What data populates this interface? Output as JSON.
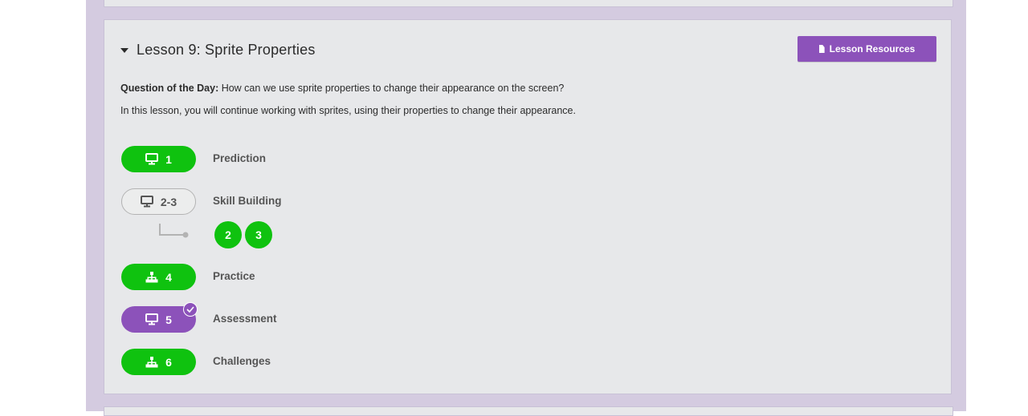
{
  "lesson": {
    "title": "Lesson 9: Sprite Properties",
    "resources_label": "Lesson Resources",
    "qotd_label": "Question of the Day:",
    "qotd_text": " How can we use sprite properties to change their appearance on the screen?",
    "description": "In this lesson, you will continue working with sprites, using their properties to change their appearance."
  },
  "steps": [
    {
      "pill": "1",
      "label": "Prediction",
      "icon": "desktop-icon",
      "status": "completed"
    },
    {
      "pill": "2-3",
      "label": "Skill Building",
      "icon": "desktop-icon",
      "status": "not-started",
      "sublevels": [
        "2",
        "3"
      ]
    },
    {
      "pill": "4",
      "label": "Practice",
      "icon": "sitemap-icon",
      "status": "completed"
    },
    {
      "pill": "5",
      "label": "Assessment",
      "icon": "desktop-icon",
      "status": "submitted"
    },
    {
      "pill": "6",
      "label": "Challenges",
      "icon": "sitemap-icon",
      "status": "completed"
    }
  ],
  "colors": {
    "completed": "#0fc20f",
    "submitted": "#8c52ba",
    "page_background": "#d4cbe0",
    "card_background": "#e7e8ea"
  }
}
